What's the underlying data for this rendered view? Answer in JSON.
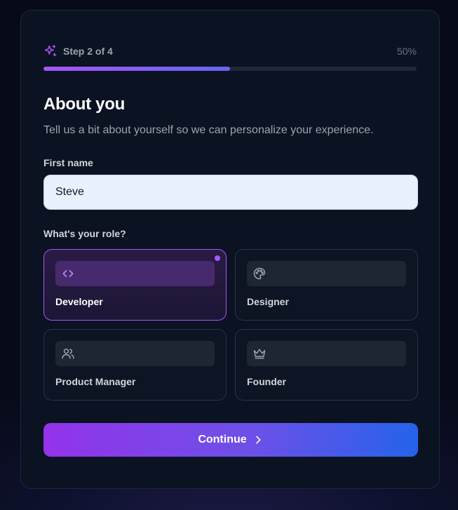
{
  "header": {
    "icon": "sparkles-icon",
    "step_label": "Step 2 of 4",
    "percent_label": "50%",
    "progress": 0.5,
    "accent_color": "#a855f7"
  },
  "form": {
    "title": "About you",
    "subtitle": "Tell us a bit about yourself so we can personalize your experience.",
    "first_name_label": "First name",
    "first_name_value": "Steve",
    "role_label": "What's your role?",
    "roles": [
      {
        "label": "Developer",
        "icon": "code-icon",
        "selected": true
      },
      {
        "label": "Designer",
        "icon": "palette-icon",
        "selected": false
      },
      {
        "label": "Product Manager",
        "icon": "users-icon",
        "selected": false
      },
      {
        "label": "Founder",
        "icon": "crown-icon",
        "selected": false
      }
    ],
    "continue_label": "Continue",
    "continue_icon": "chevron-right-icon"
  }
}
